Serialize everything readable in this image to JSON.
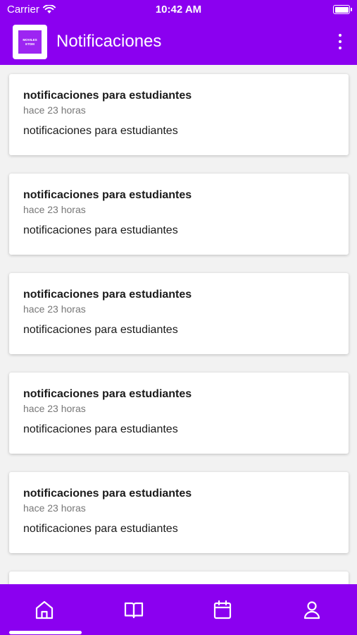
{
  "status_bar": {
    "carrier": "Carrier",
    "time": "10:42 AM"
  },
  "app_bar": {
    "logo_text_line1": "MOVILES",
    "logo_text_line2": "ETDM",
    "title": "Notificaciones"
  },
  "notifications": [
    {
      "title": "notificaciones para estudiantes",
      "time": "hace 23 horas",
      "body": "notificaciones para estudiantes"
    },
    {
      "title": "notificaciones para estudiantes",
      "time": "hace 23 horas",
      "body": "notificaciones para estudiantes"
    },
    {
      "title": "notificaciones para estudiantes",
      "time": "hace 23 horas",
      "body": "notificaciones para estudiantes"
    },
    {
      "title": "notificaciones para estudiantes",
      "time": "hace 23 horas",
      "body": "notificaciones para estudiantes"
    },
    {
      "title": "notificaciones para estudiantes",
      "time": "hace 23 horas",
      "body": "notificaciones para estudiantes"
    }
  ],
  "tabs": [
    {
      "icon": "home-icon"
    },
    {
      "icon": "book-icon"
    },
    {
      "icon": "calendar-icon"
    },
    {
      "icon": "user-icon"
    }
  ],
  "colors": {
    "accent": "#8b00f0",
    "background": "#f2f2f2",
    "card": "#ffffff"
  }
}
